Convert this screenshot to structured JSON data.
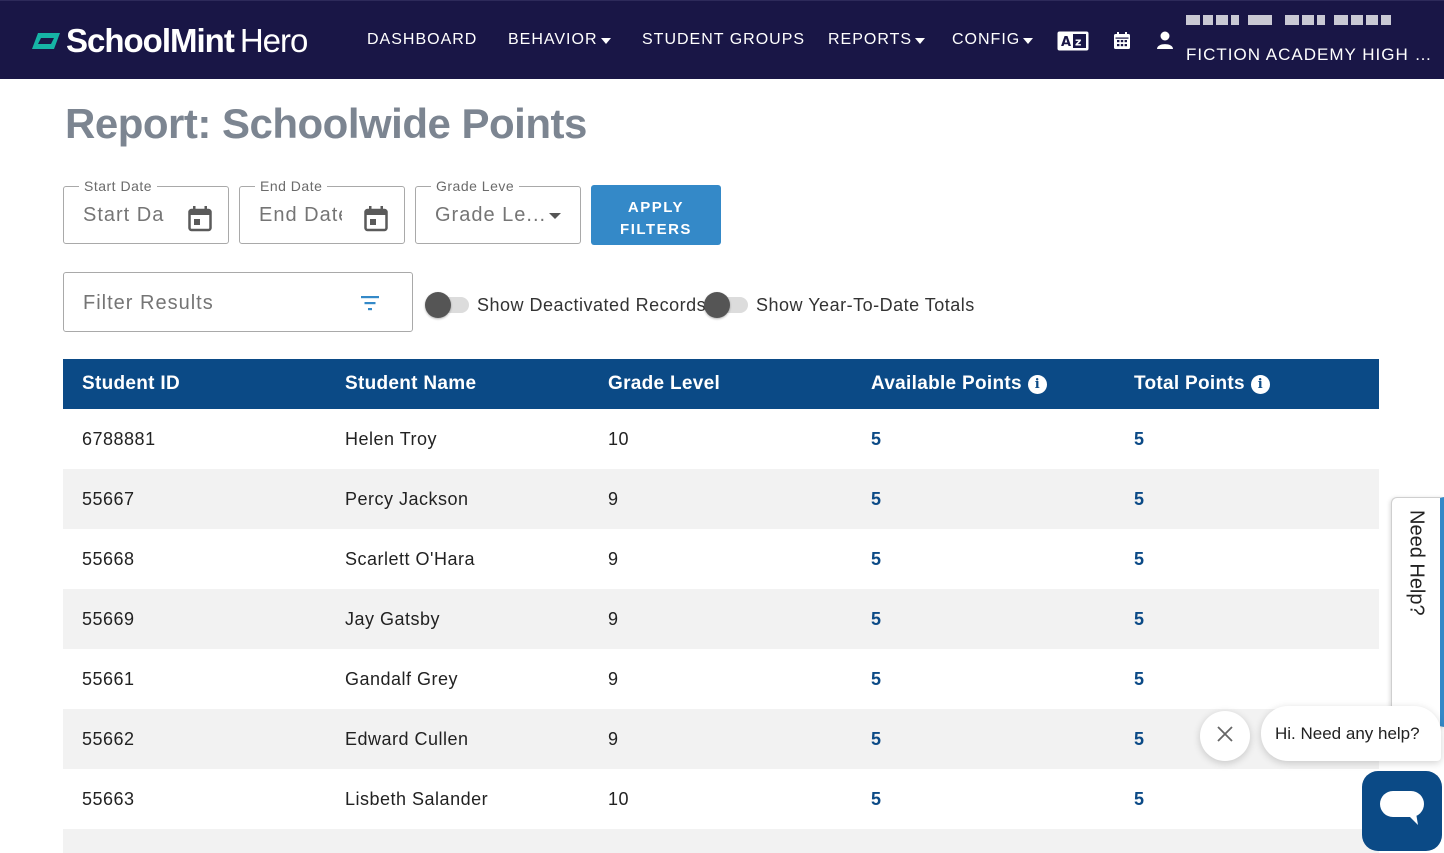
{
  "navbar": {
    "brand_bold": "SchoolMint",
    "brand_light": "Hero",
    "items": [
      "DASHBOARD",
      "BEHAVIOR",
      "STUDENT GROUPS",
      "REPORTS",
      "CONFIG"
    ],
    "school_name": "FICTION ACADEMY HIGH S..."
  },
  "page": {
    "title": "Report: Schoolwide Points"
  },
  "filters": {
    "start_date": {
      "legend": "Start Date",
      "placeholder": "Start Da"
    },
    "end_date": {
      "legend": "End Date",
      "placeholder": "End Date"
    },
    "grade_level": {
      "legend": "Grade Leve",
      "placeholder": "Grade Le..."
    },
    "apply_label_line1": "APPLY",
    "apply_label_line2": "FILTERS",
    "search_placeholder": "Filter Results",
    "toggle_deactivated": "Show Deactivated Records",
    "toggle_ytd": "Show Year-To-Date Totals"
  },
  "table": {
    "columns": [
      "Student ID",
      "Student Name",
      "Grade Level",
      "Available Points",
      "Total Points"
    ],
    "rows": [
      [
        "6788881",
        "Helen Troy",
        "10",
        "5",
        "5"
      ],
      [
        "55667",
        "Percy Jackson",
        "9",
        "5",
        "5"
      ],
      [
        "55668",
        "Scarlett O'Hara",
        "9",
        "5",
        "5"
      ],
      [
        "55669",
        "Jay Gatsby",
        "9",
        "5",
        "5"
      ],
      [
        "55661",
        "Gandalf Grey",
        "9",
        "5",
        "5"
      ],
      [
        "55662",
        "Edward Cullen",
        "9",
        "5",
        "5"
      ],
      [
        "55663",
        "Lisbeth Salander",
        "10",
        "5",
        "5"
      ]
    ]
  },
  "help": {
    "tab_label": "Need Help?",
    "bubble_text": "Hi. Need any help?"
  },
  "colors": {
    "navbar": "#191646",
    "accent": "#3489c8",
    "table_header": "#0b4a86"
  }
}
